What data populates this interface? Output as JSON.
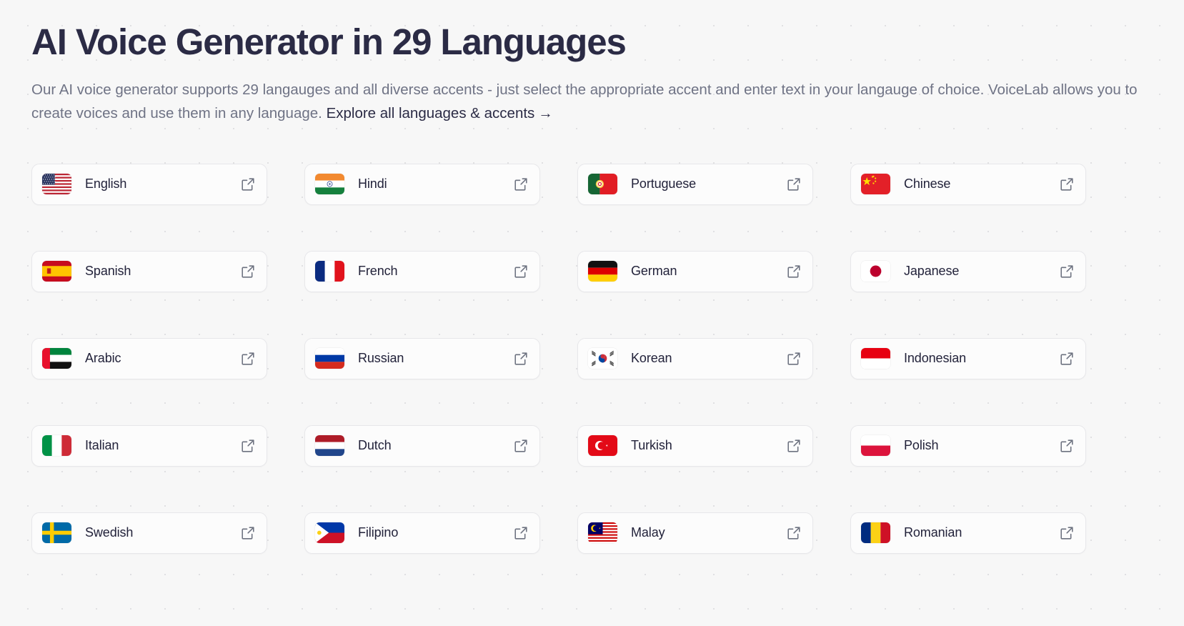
{
  "header": {
    "title": "AI Voice Generator in 29 Languages",
    "subtitle_text": "Our AI voice generator supports 29 langauges and all diverse accents - just select the appropriate accent and enter text in your langauge of choice. VoiceLab allows you to create voices and use them in any language.",
    "explore_link_label": "Explore all languages & accents",
    "explore_link_arrow": "→"
  },
  "colors": {
    "page_background": "#f7f7f7",
    "dot_grid": "#e0e0e2",
    "title": "#2b2b45",
    "subtitle": "#6f7385",
    "card_background": "#fcfcfc",
    "card_border": "#e7e7ea",
    "label": "#22223a",
    "icon": "#6d7280"
  },
  "languages": [
    {
      "label": "English",
      "flag": "us",
      "icon": "external-link-icon"
    },
    {
      "label": "Hindi",
      "flag": "in",
      "icon": "external-link-icon"
    },
    {
      "label": "Portuguese",
      "flag": "pt",
      "icon": "external-link-icon"
    },
    {
      "label": "Chinese",
      "flag": "cn",
      "icon": "external-link-icon"
    },
    {
      "label": "Spanish",
      "flag": "es",
      "icon": "external-link-icon"
    },
    {
      "label": "French",
      "flag": "fr",
      "icon": "external-link-icon"
    },
    {
      "label": "German",
      "flag": "de",
      "icon": "external-link-icon"
    },
    {
      "label": "Japanese",
      "flag": "jp",
      "icon": "external-link-icon"
    },
    {
      "label": "Arabic",
      "flag": "ae",
      "icon": "external-link-icon"
    },
    {
      "label": "Russian",
      "flag": "ru",
      "icon": "external-link-icon"
    },
    {
      "label": "Korean",
      "flag": "kr",
      "icon": "external-link-icon"
    },
    {
      "label": "Indonesian",
      "flag": "id",
      "icon": "external-link-icon"
    },
    {
      "label": "Italian",
      "flag": "it",
      "icon": "external-link-icon"
    },
    {
      "label": "Dutch",
      "flag": "nl",
      "icon": "external-link-icon"
    },
    {
      "label": "Turkish",
      "flag": "tr",
      "icon": "external-link-icon"
    },
    {
      "label": "Polish",
      "flag": "pl",
      "icon": "external-link-icon"
    },
    {
      "label": "Swedish",
      "flag": "se",
      "icon": "external-link-icon"
    },
    {
      "label": "Filipino",
      "flag": "ph",
      "icon": "external-link-icon"
    },
    {
      "label": "Malay",
      "flag": "my",
      "icon": "external-link-icon"
    },
    {
      "label": "Romanian",
      "flag": "ro",
      "icon": "external-link-icon"
    }
  ]
}
